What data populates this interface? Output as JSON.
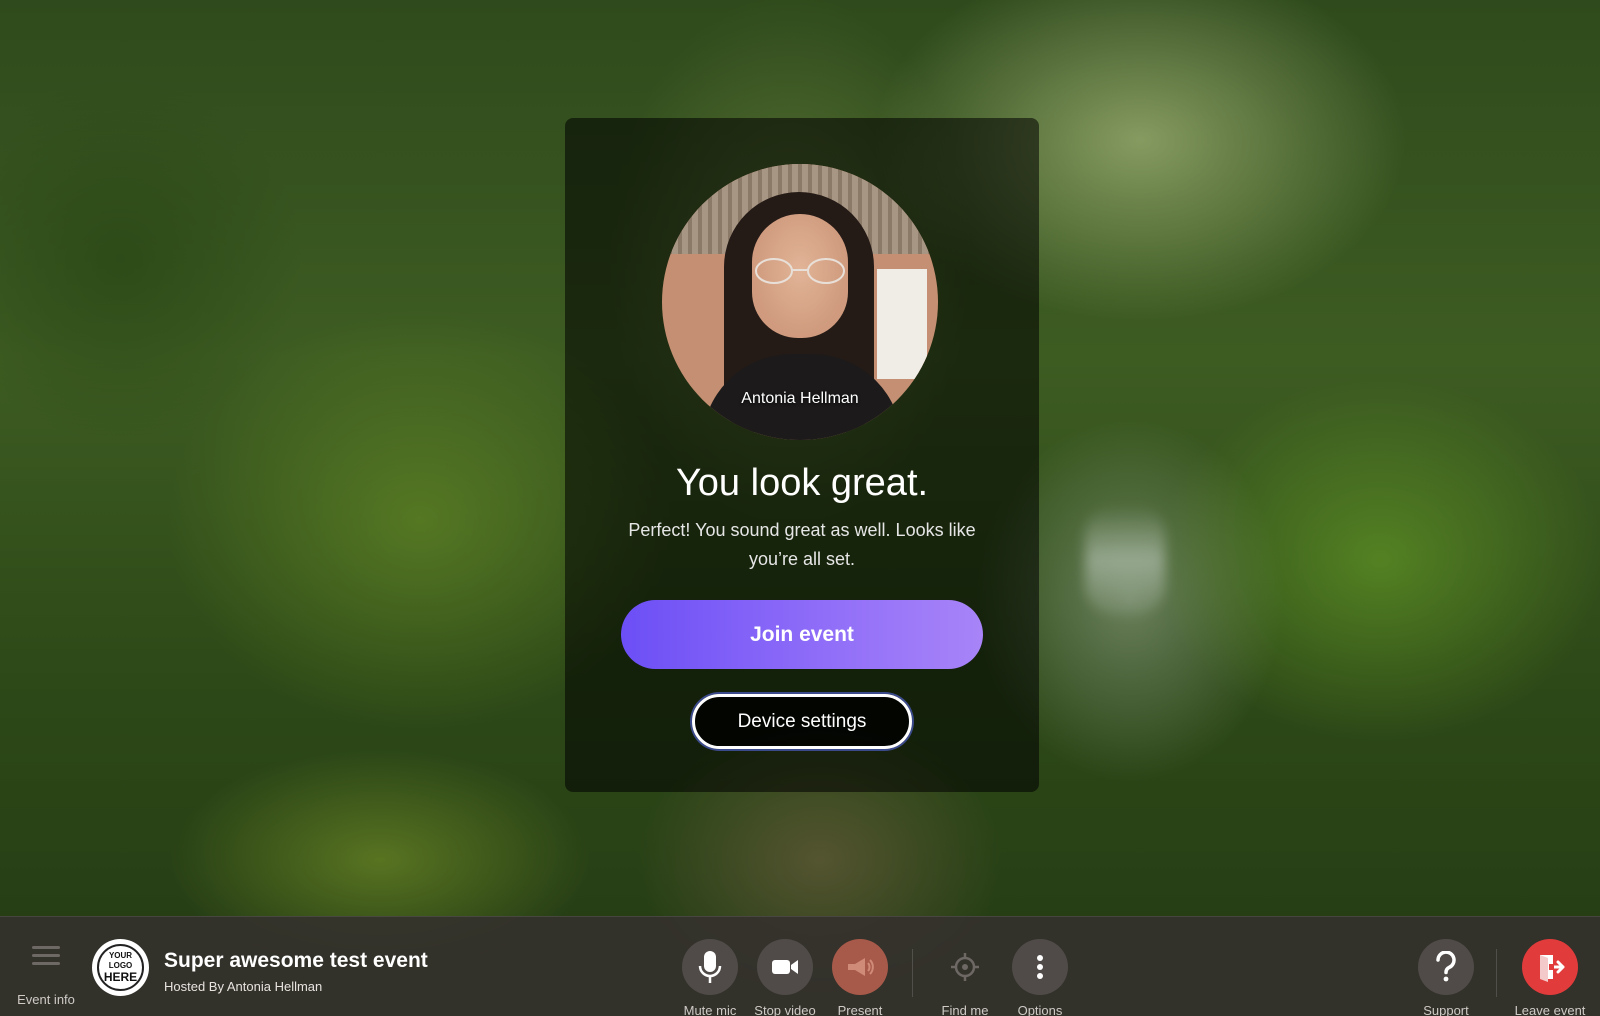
{
  "preview": {
    "participant_name": "Antonia Hellman",
    "headline": "You look great.",
    "message": "Perfect! You sound great as well. Looks like you’re all set.",
    "join_label": "Join event",
    "device_settings_label": "Device settings"
  },
  "event": {
    "logo_lines": [
      "YOUR",
      "LOGO",
      "HERE"
    ],
    "title": "Super awesome test event",
    "host_line": "Hosted By Antonia Hellman"
  },
  "toolbar": {
    "event_info_label": "Event info",
    "mute_mic_label": "Mute mic",
    "stop_video_label": "Stop video",
    "present_label": "Present",
    "find_me_label": "Find me",
    "options_label": "Options",
    "support_label": "Support",
    "leave_label": "Leave event"
  },
  "colors": {
    "join_gradient_start": "#6c4ff6",
    "join_gradient_end": "#a884f8",
    "present_button": "#a85a4a",
    "leave_button": "#e23b3b",
    "toolbar_bg": "#34302e"
  },
  "icons": {
    "event_info": "hamburger-menu-icon",
    "mute_mic": "microphone-icon",
    "stop_video": "video-camera-icon",
    "present": "megaphone-icon",
    "find_me": "crosshair-icon",
    "options": "vertical-dots-icon",
    "support": "question-mark-icon",
    "leave": "exit-door-icon"
  }
}
